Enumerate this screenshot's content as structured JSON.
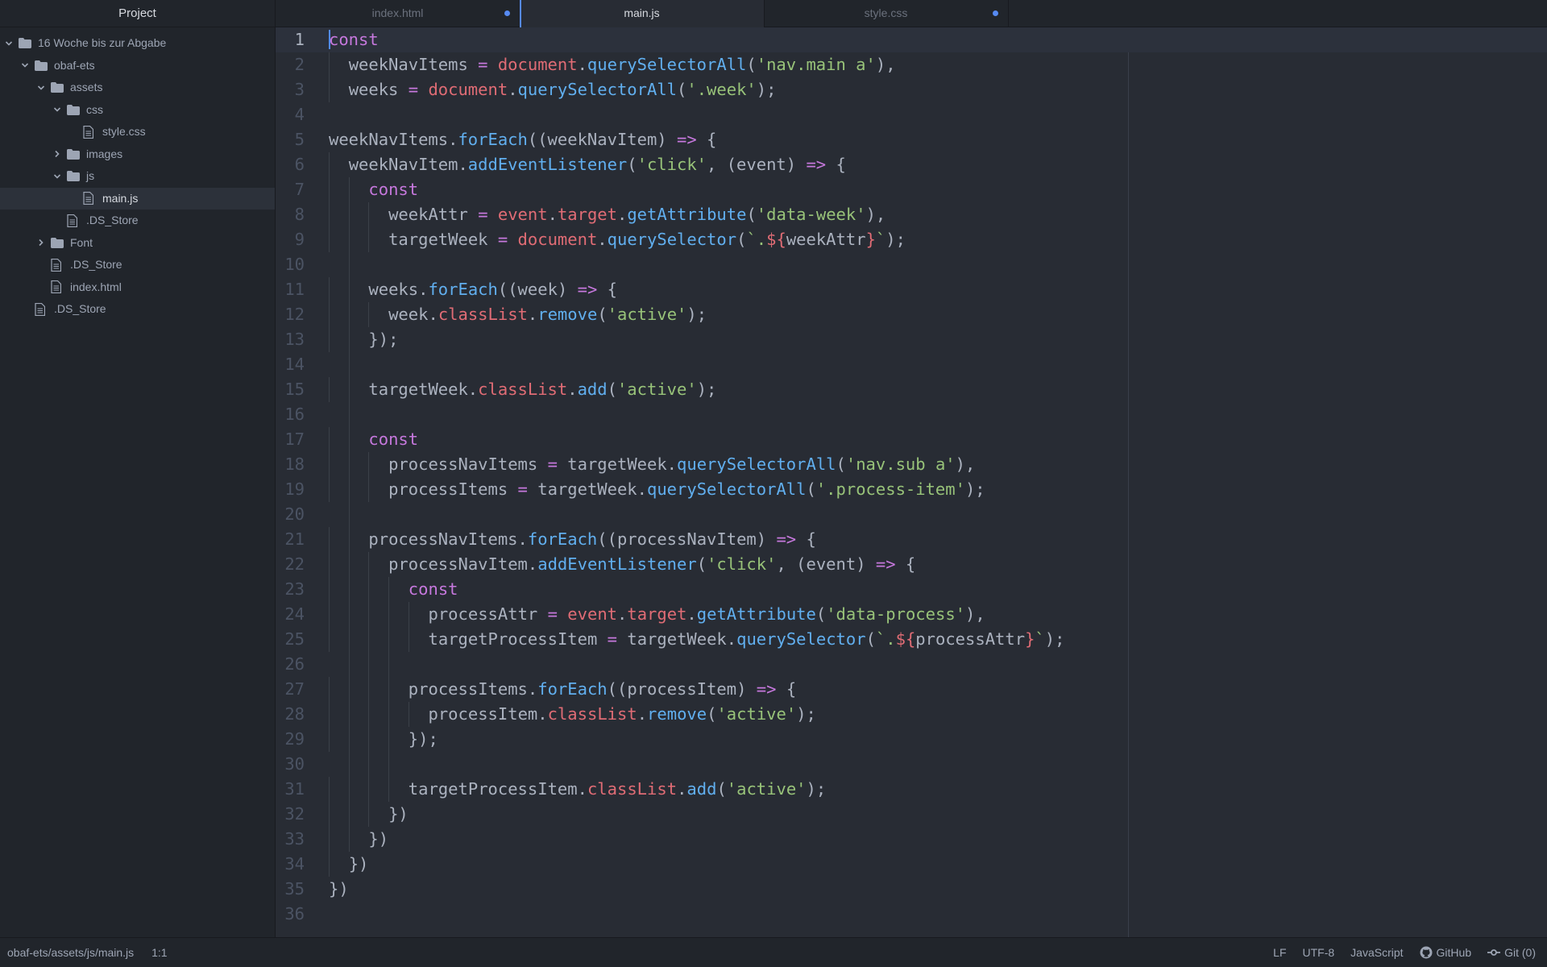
{
  "sidebar": {
    "title": "Project",
    "items": [
      {
        "label": "16 Woche bis zur Abgabe",
        "type": "folder",
        "expanded": true,
        "depth": 0
      },
      {
        "label": "obaf-ets",
        "type": "folder",
        "expanded": true,
        "depth": 1
      },
      {
        "label": "assets",
        "type": "folder",
        "expanded": true,
        "depth": 2
      },
      {
        "label": "css",
        "type": "folder",
        "expanded": true,
        "depth": 3
      },
      {
        "label": "style.css",
        "type": "file",
        "depth": 4
      },
      {
        "label": "images",
        "type": "folder",
        "expanded": false,
        "depth": 3
      },
      {
        "label": "js",
        "type": "folder",
        "expanded": true,
        "depth": 3
      },
      {
        "label": "main.js",
        "type": "file",
        "depth": 4,
        "selected": true
      },
      {
        "label": ".DS_Store",
        "type": "file",
        "depth": 3
      },
      {
        "label": "Font",
        "type": "folder",
        "expanded": false,
        "depth": 2
      },
      {
        "label": ".DS_Store",
        "type": "file",
        "depth": 2
      },
      {
        "label": "index.html",
        "type": "file",
        "depth": 2
      },
      {
        "label": ".DS_Store",
        "type": "file",
        "depth": 1
      }
    ]
  },
  "tabs": [
    {
      "label": "index.html",
      "active": false,
      "modified": true
    },
    {
      "label": "main.js",
      "active": true,
      "modified": false
    },
    {
      "label": "style.css",
      "active": false,
      "modified": true
    }
  ],
  "editor": {
    "lines": [
      {
        "n": "1",
        "indent": 0,
        "tokens": [
          [
            "k",
            "const"
          ]
        ]
      },
      {
        "n": "2",
        "indent": 1,
        "tokens": [
          [
            "p",
            "weekNavItems "
          ],
          [
            "o",
            "="
          ],
          [
            "p",
            " "
          ],
          [
            "r",
            "document"
          ],
          [
            "p",
            "."
          ],
          [
            "f",
            "querySelectorAll"
          ],
          [
            "p",
            "("
          ],
          [
            "s",
            "'nav.main a'"
          ],
          [
            "p",
            "),"
          ]
        ]
      },
      {
        "n": "3",
        "indent": 1,
        "tokens": [
          [
            "p",
            "weeks "
          ],
          [
            "o",
            "="
          ],
          [
            "p",
            " "
          ],
          [
            "r",
            "document"
          ],
          [
            "p",
            "."
          ],
          [
            "f",
            "querySelectorAll"
          ],
          [
            "p",
            "("
          ],
          [
            "s",
            "'.week'"
          ],
          [
            "p",
            ");"
          ]
        ]
      },
      {
        "n": "4",
        "indent": 0,
        "tokens": []
      },
      {
        "n": "5",
        "indent": 0,
        "tokens": [
          [
            "p",
            "weekNavItems."
          ],
          [
            "f",
            "forEach"
          ],
          [
            "p",
            "((weekNavItem) "
          ],
          [
            "o",
            "=>"
          ],
          [
            "p",
            " {"
          ]
        ]
      },
      {
        "n": "6",
        "indent": 1,
        "tokens": [
          [
            "p",
            "weekNavItem."
          ],
          [
            "f",
            "addEventListener"
          ],
          [
            "p",
            "("
          ],
          [
            "s",
            "'click'"
          ],
          [
            "p",
            ", (event) "
          ],
          [
            "o",
            "=>"
          ],
          [
            "p",
            " {"
          ]
        ]
      },
      {
        "n": "7",
        "indent": 2,
        "tokens": [
          [
            "k",
            "const"
          ]
        ]
      },
      {
        "n": "8",
        "indent": 3,
        "tokens": [
          [
            "p",
            "weekAttr "
          ],
          [
            "o",
            "="
          ],
          [
            "p",
            " "
          ],
          [
            "r",
            "event"
          ],
          [
            "p",
            "."
          ],
          [
            "r",
            "target"
          ],
          [
            "p",
            "."
          ],
          [
            "f",
            "getAttribute"
          ],
          [
            "p",
            "("
          ],
          [
            "s",
            "'data-week'"
          ],
          [
            "p",
            "),"
          ]
        ]
      },
      {
        "n": "9",
        "indent": 3,
        "tokens": [
          [
            "p",
            "targetWeek "
          ],
          [
            "o",
            "="
          ],
          [
            "p",
            " "
          ],
          [
            "r",
            "document"
          ],
          [
            "p",
            "."
          ],
          [
            "f",
            "querySelector"
          ],
          [
            "p",
            "("
          ],
          [
            "s",
            "`."
          ],
          [
            "r",
            "${"
          ],
          [
            "p",
            "weekAttr"
          ],
          [
            "r",
            "}"
          ],
          [
            "s",
            "`"
          ],
          [
            "p",
            ");"
          ]
        ]
      },
      {
        "n": "10",
        "indent": 0,
        "tokens": []
      },
      {
        "n": "11",
        "indent": 2,
        "tokens": [
          [
            "p",
            "weeks."
          ],
          [
            "f",
            "forEach"
          ],
          [
            "p",
            "((week) "
          ],
          [
            "o",
            "=>"
          ],
          [
            "p",
            " {"
          ]
        ]
      },
      {
        "n": "12",
        "indent": 3,
        "tokens": [
          [
            "p",
            "week."
          ],
          [
            "r",
            "classList"
          ],
          [
            "p",
            "."
          ],
          [
            "f",
            "remove"
          ],
          [
            "p",
            "("
          ],
          [
            "s",
            "'active'"
          ],
          [
            "p",
            ");"
          ]
        ]
      },
      {
        "n": "13",
        "indent": 2,
        "tokens": [
          [
            "p",
            "});"
          ]
        ]
      },
      {
        "n": "14",
        "indent": 0,
        "tokens": []
      },
      {
        "n": "15",
        "indent": 2,
        "tokens": [
          [
            "p",
            "targetWeek."
          ],
          [
            "r",
            "classList"
          ],
          [
            "p",
            "."
          ],
          [
            "f",
            "add"
          ],
          [
            "p",
            "("
          ],
          [
            "s",
            "'active'"
          ],
          [
            "p",
            ");"
          ]
        ]
      },
      {
        "n": "16",
        "indent": 0,
        "tokens": []
      },
      {
        "n": "17",
        "indent": 2,
        "tokens": [
          [
            "k",
            "const"
          ]
        ]
      },
      {
        "n": "18",
        "indent": 3,
        "tokens": [
          [
            "p",
            "processNavItems "
          ],
          [
            "o",
            "="
          ],
          [
            "p",
            " targetWeek."
          ],
          [
            "f",
            "querySelectorAll"
          ],
          [
            "p",
            "("
          ],
          [
            "s",
            "'nav.sub a'"
          ],
          [
            "p",
            "),"
          ]
        ]
      },
      {
        "n": "19",
        "indent": 3,
        "tokens": [
          [
            "p",
            "processItems "
          ],
          [
            "o",
            "="
          ],
          [
            "p",
            " targetWeek."
          ],
          [
            "f",
            "querySelectorAll"
          ],
          [
            "p",
            "("
          ],
          [
            "s",
            "'.process-item'"
          ],
          [
            "p",
            ");"
          ]
        ]
      },
      {
        "n": "20",
        "indent": 0,
        "tokens": []
      },
      {
        "n": "21",
        "indent": 2,
        "tokens": [
          [
            "p",
            "processNavItems."
          ],
          [
            "f",
            "forEach"
          ],
          [
            "p",
            "((processNavItem) "
          ],
          [
            "o",
            "=>"
          ],
          [
            "p",
            " {"
          ]
        ]
      },
      {
        "n": "22",
        "indent": 3,
        "tokens": [
          [
            "p",
            "processNavItem."
          ],
          [
            "f",
            "addEventListener"
          ],
          [
            "p",
            "("
          ],
          [
            "s",
            "'click'"
          ],
          [
            "p",
            ", (event) "
          ],
          [
            "o",
            "=>"
          ],
          [
            "p",
            " {"
          ]
        ]
      },
      {
        "n": "23",
        "indent": 4,
        "tokens": [
          [
            "k",
            "const"
          ]
        ]
      },
      {
        "n": "24",
        "indent": 5,
        "tokens": [
          [
            "p",
            "processAttr "
          ],
          [
            "o",
            "="
          ],
          [
            "p",
            " "
          ],
          [
            "r",
            "event"
          ],
          [
            "p",
            "."
          ],
          [
            "r",
            "target"
          ],
          [
            "p",
            "."
          ],
          [
            "f",
            "getAttribute"
          ],
          [
            "p",
            "("
          ],
          [
            "s",
            "'data-process'"
          ],
          [
            "p",
            "),"
          ]
        ]
      },
      {
        "n": "25",
        "indent": 5,
        "tokens": [
          [
            "p",
            "targetProcessItem "
          ],
          [
            "o",
            "="
          ],
          [
            "p",
            " targetWeek."
          ],
          [
            "f",
            "querySelector"
          ],
          [
            "p",
            "("
          ],
          [
            "s",
            "`."
          ],
          [
            "r",
            "${"
          ],
          [
            "p",
            "processAttr"
          ],
          [
            "r",
            "}"
          ],
          [
            "s",
            "`"
          ],
          [
            "p",
            ");"
          ]
        ]
      },
      {
        "n": "26",
        "indent": 0,
        "tokens": []
      },
      {
        "n": "27",
        "indent": 4,
        "tokens": [
          [
            "p",
            "processItems."
          ],
          [
            "f",
            "forEach"
          ],
          [
            "p",
            "((processItem) "
          ],
          [
            "o",
            "=>"
          ],
          [
            "p",
            " {"
          ]
        ]
      },
      {
        "n": "28",
        "indent": 5,
        "tokens": [
          [
            "p",
            "processItem."
          ],
          [
            "r",
            "classList"
          ],
          [
            "p",
            "."
          ],
          [
            "f",
            "remove"
          ],
          [
            "p",
            "("
          ],
          [
            "s",
            "'active'"
          ],
          [
            "p",
            ");"
          ]
        ]
      },
      {
        "n": "29",
        "indent": 4,
        "tokens": [
          [
            "p",
            "});"
          ]
        ]
      },
      {
        "n": "30",
        "indent": 0,
        "tokens": []
      },
      {
        "n": "31",
        "indent": 4,
        "tokens": [
          [
            "p",
            "targetProcessItem."
          ],
          [
            "r",
            "classList"
          ],
          [
            "p",
            "."
          ],
          [
            "f",
            "add"
          ],
          [
            "p",
            "("
          ],
          [
            "s",
            "'active'"
          ],
          [
            "p",
            ");"
          ]
        ]
      },
      {
        "n": "32",
        "indent": 3,
        "tokens": [
          [
            "p",
            "})"
          ]
        ]
      },
      {
        "n": "33",
        "indent": 2,
        "tokens": [
          [
            "p",
            "})"
          ]
        ]
      },
      {
        "n": "34",
        "indent": 1,
        "tokens": [
          [
            "p",
            "})"
          ]
        ]
      },
      {
        "n": "35",
        "indent": 0,
        "tokens": [
          [
            "p",
            "})"
          ]
        ]
      },
      {
        "n": "36",
        "indent": 0,
        "tokens": []
      }
    ]
  },
  "statusbar": {
    "file_path": "obaf-ets/assets/js/main.js",
    "cursor_position": "1:1",
    "line_ending": "LF",
    "encoding": "UTF-8",
    "grammar": "JavaScript",
    "github_label": "GitHub",
    "git_label": "Git (0)"
  },
  "colors": {
    "accent": "#568af2",
    "keyword": "#c678dd",
    "function": "#61afef",
    "string": "#98c379",
    "variable": "#e06c75"
  }
}
